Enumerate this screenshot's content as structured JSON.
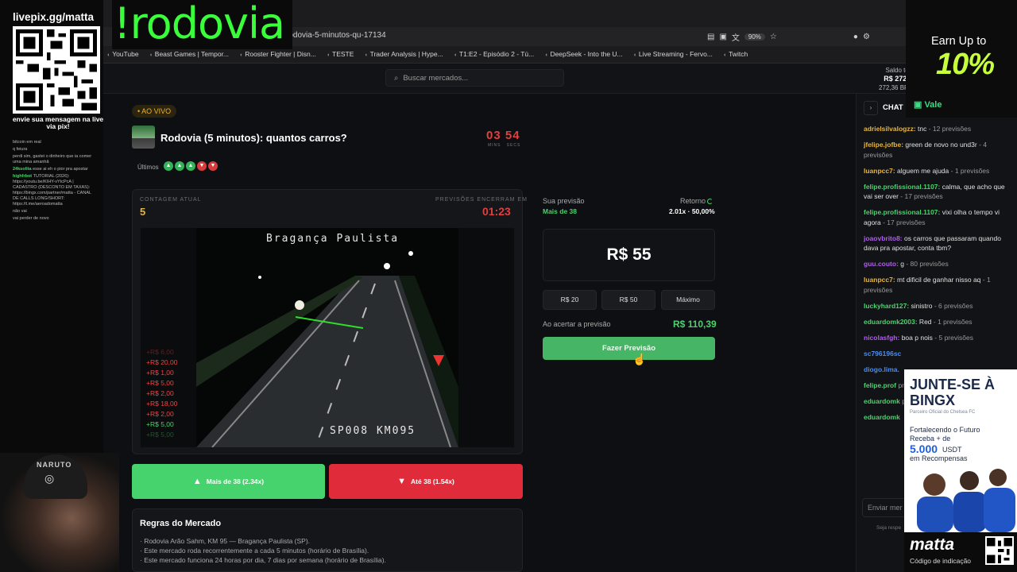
{
  "browser": {
    "url": "rodovia-5-minutos-qu-17134",
    "zoom": "90%",
    "bookmarks": [
      "YouTube",
      "Beast Games | Tempor...",
      "Rooster Fighter | Disn...",
      "TESTE",
      "Trader Analysis | Hype...",
      "T1:E2 - Episódio 2 - Tú...",
      "DeepSeek - Into the U...",
      "Live Streaming - Fervo...",
      "Twitch"
    ]
  },
  "header": {
    "search_placeholder": "Buscar mercados...",
    "saldo_label": "Saldo to",
    "saldo_value": "R$ 272,",
    "saldo_sub": "272,36 BR"
  },
  "market": {
    "live_badge": "• AO VIVO",
    "title": "Rodovia (5 minutos): quantos carros?",
    "timer_min": "03",
    "timer_sec": "54",
    "timer_units": "MINS   SECS",
    "last_label": "Últimos",
    "last_results": [
      "up",
      "up",
      "up",
      "down",
      "down"
    ],
    "count_label": "CONTAGEM ATUAL",
    "count_value": "5",
    "close_label": "PREVISÕES ENCERRAM EM",
    "close_value": "01:23",
    "cam_top_text": "Bragança Paulista",
    "cam_bottom_text": "SP008 KM095",
    "donations": [
      "+R$ 6,00",
      "+R$ 20,00",
      "+R$ 1,00",
      "+R$ 5,00",
      "+R$ 2,00",
      "+R$ 18,00",
      "+R$ 2,00",
      "+R$ 5,00",
      "+R$ 5,00"
    ],
    "btn_up": "Mais de 38 (2.34x)",
    "btn_down": "Até 38 (1.54x)",
    "rules_title": "Regras do Mercado",
    "rules": [
      "Rodovia Arão Sahm, KM 95 — Bragança Paulista (SP).",
      "Este mercado roda recorrentemente a cada 5 minutos (horário de Brasília).",
      "Este mercado funciona 24 horas por dia, 7 dias por semana (horário de Brasília)."
    ]
  },
  "prediction": {
    "label": "Sua previsão",
    "choice": "Mais de 38",
    "return_label": "Retorno",
    "return_value": "2.01x · 50,00%",
    "amount": "R$ 55",
    "chips": [
      "R$ 20",
      "R$ 50",
      "Máximo"
    ],
    "win_label": "Ao acertar a previsão",
    "win_value": "R$ 110,39",
    "submit": "Fazer Previsão"
  },
  "chat": {
    "title": "CHAT",
    "messages": [
      {
        "user": "adrielsilvalogzz:",
        "color": "#e7b43c",
        "text": "tnc",
        "count": "- 12 previsões"
      },
      {
        "user": "jfelipe.jofbe:",
        "color": "#e7b43c",
        "text": "green de novo no und3r",
        "count": "- 4 previsões"
      },
      {
        "user": "luanpcc7:",
        "color": "#e7b43c",
        "text": "alguem me ajuda",
        "count": "- 1 previsões"
      },
      {
        "user": "felipe.profissional.1107:",
        "color": "#4bd26e",
        "text": "calma, que acho que vai ser over",
        "count": "- 17 previsões"
      },
      {
        "user": "felipe.profissional.1107:",
        "color": "#4bd26e",
        "text": "vixi olha o tempo vi agora",
        "count": "- 17 previsões"
      },
      {
        "user": "joaovbrito8:",
        "color": "#b05cf0",
        "text": "os carros que passaram quando dava pra apostar, conta tbm?",
        "count": ""
      },
      {
        "user": "guu.couto:",
        "color": "#b05cf0",
        "text": "g",
        "count": "- 80 previsões"
      },
      {
        "user": "luanpcc7:",
        "color": "#e7b43c",
        "text": "mt dificil de ganhar nisso aq",
        "count": "- 1 previsões"
      },
      {
        "user": "luckyhard127:",
        "color": "#4bd26e",
        "text": "sinistro",
        "count": "- 6 previsões"
      },
      {
        "user": "eduardomk2003:",
        "color": "#4bd26e",
        "text": "Red",
        "count": "- 1 previsões"
      },
      {
        "user": "nicolasfgh:",
        "color": "#b05cf0",
        "text": "boa p nois",
        "count": "- 5 previsões"
      },
      {
        "user": "sc796196sc",
        "color": "#4b8cf0",
        "text": "",
        "count": ""
      },
      {
        "user": "diogo.lima.",
        "color": "#4b8cf0",
        "text": "",
        "count": ""
      },
      {
        "user": "felipe.prof",
        "color": "#4bd26e",
        "text": "",
        "count": "previsões"
      },
      {
        "user": "eduardomk",
        "color": "#4bd26e",
        "text": "",
        "count": "previsões"
      },
      {
        "user": "eduardomk",
        "color": "#4bd26e",
        "text": "",
        "count": ""
      }
    ],
    "input_placeholder": "Enviar mer",
    "note": "Seja respe"
  },
  "overlay": {
    "pix_title": "livepix.gg/matta",
    "pix_caption": "envie sua mensagem na live via pix!",
    "command": "!rodovia",
    "mini_chat": [
      {
        "u": "",
        "t": "bitcoin em real"
      },
      {
        "u": "",
        "t": "q feiura"
      },
      {
        "u": "",
        "t": "perdi sim, gastei o dinheiro que ia comer uma mina amanhã"
      },
      {
        "u": "24ksolita",
        "t": "esse ai eh o pior pra apostar"
      },
      {
        "u": "highfrbot",
        "t": "TUTORIAL (2026): https://youtu.be/KIHY-vYtcPcA | CADASTRO (DESCONTO EM TAXAS): https://bingx.com/partner/matta - CANAL DE CALLS LONG/SHORT: https://t.me/aeroadomatta"
      },
      {
        "u": "",
        "t": "não vai"
      },
      {
        "u": "",
        "t": "vai perder de novo"
      }
    ],
    "cap_text": "NARUTO",
    "earn_line1": "Earn Up to",
    "earn_line2": "10%",
    "earn_brand": "Vale",
    "bingx_h1": "JUNTE-SE À BINGX",
    "bingx_sub": "Parceiro Oficial do Chelsea FC",
    "bingx_t1": "Fortalecendo o Futuro Receba + de",
    "bingx_num": "5.000",
    "bingx_usdt": "USDT",
    "bingx_t2": "em Recompensas",
    "matta": "matta",
    "matta_code": "Código de indicação"
  },
  "colors": {
    "green": "#46d36e",
    "red": "#e02c3a",
    "accent_yellow": "#e7b43c",
    "command_green": "#39ff3a"
  }
}
